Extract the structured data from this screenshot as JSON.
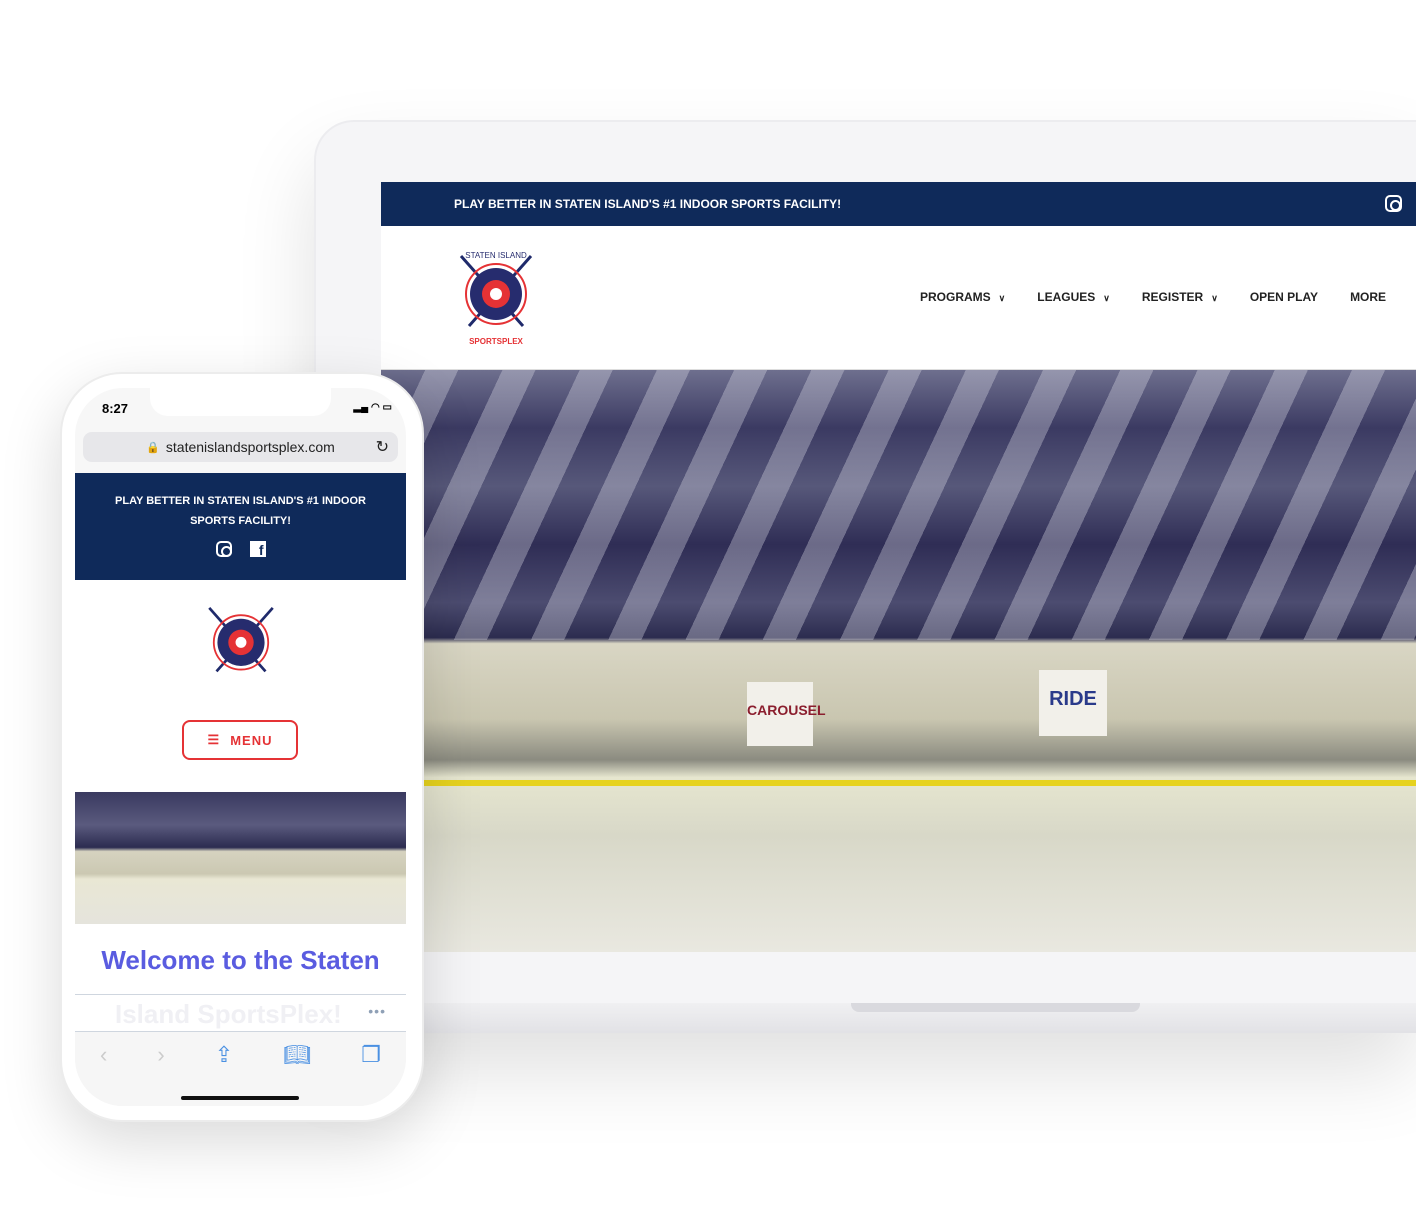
{
  "desktop": {
    "topbar_text": "PLAY BETTER IN STATEN ISLAND'S #1 INDOOR SPORTS FACILITY!",
    "logo_text": "STATEN ISLAND SPORTSPLEX",
    "nav": [
      {
        "label": "PROGRAMS",
        "dropdown": true
      },
      {
        "label": "LEAGUES",
        "dropdown": true
      },
      {
        "label": "REGISTER",
        "dropdown": true
      },
      {
        "label": "OPEN PLAY",
        "dropdown": false
      },
      {
        "label": "MORE",
        "dropdown": false
      }
    ],
    "hero_banners": [
      "CAROUSEL",
      "RIDE"
    ]
  },
  "phone": {
    "time": "8:27",
    "url": "statenislandsportsplex.com",
    "topbar_text": "PLAY BETTER IN STATEN ISLAND'S #1 INDOOR SPORTS FACILITY!",
    "menu_label": "MENU",
    "welcome": "Welcome to the Staten",
    "welcome_overflow": "Island SportsPlex!",
    "more_dots": "•••"
  },
  "colors": {
    "navy": "#0f2a5a",
    "red": "#e53235",
    "heading": "#5a5ce0",
    "ios_blue": "#4a90e2"
  }
}
